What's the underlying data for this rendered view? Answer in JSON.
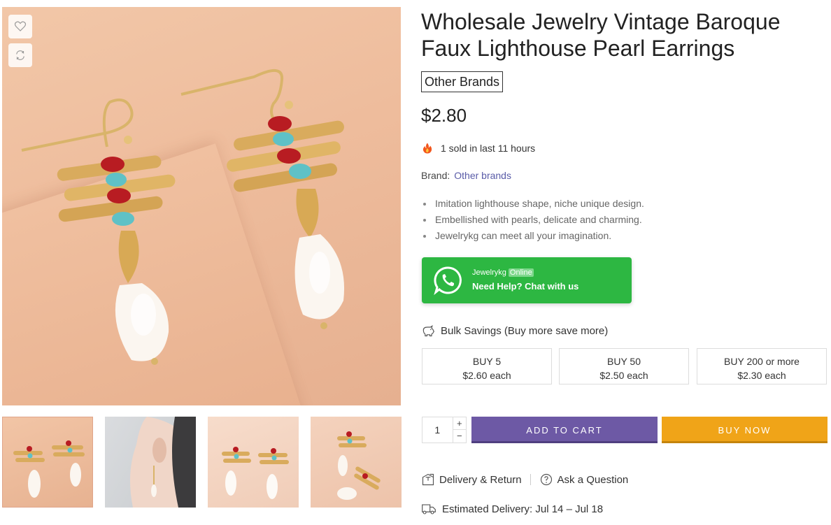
{
  "product": {
    "title": "Wholesale Jewelry Vintage Baroque Faux Lighthouse Pearl Earrings",
    "brand_badge": "Other Brands",
    "price": "$2.80",
    "sold_text": "1 sold in last 11 hours",
    "brand_label": "Brand:",
    "brand_link": "Other brands",
    "features": [
      "Imitation lighthouse shape, niche unique design.",
      "Embellished with pearls, delicate and charming.",
      "Jewelrykg can meet all your imagination."
    ]
  },
  "whatsapp": {
    "name": "Jewelrykg",
    "status": "Online",
    "cta": "Need Help? Chat with us",
    "color": "#2db742"
  },
  "bulk": {
    "heading": "Bulk Savings (Buy more save more)",
    "tiers": [
      {
        "qty": "BUY 5",
        "price": "$2.60 each"
      },
      {
        "qty": "BUY 50",
        "price": "$2.50 each"
      },
      {
        "qty": "BUY 200 or more",
        "price": "$2.30 each"
      }
    ]
  },
  "cart": {
    "quantity": "1",
    "plus": "+",
    "minus": "−",
    "add_to_cart": "ADD TO CART",
    "buy_now": "BUY NOW",
    "add_color": "#6d59a5",
    "buy_color": "#f0a418"
  },
  "links": {
    "delivery_return": "Delivery & Return",
    "ask_question": "Ask a Question"
  },
  "delivery": {
    "estimated": "Estimated Delivery: Jul 14 – Jul 18"
  },
  "icons": {
    "wishlist": "heart-icon",
    "compare": "refresh-icon",
    "sold": "fire-icon",
    "whatsapp": "whatsapp-icon",
    "bulk": "piggy-bank-icon",
    "delivery_return": "box-return-icon",
    "ask": "question-icon",
    "truck": "truck-icon"
  }
}
